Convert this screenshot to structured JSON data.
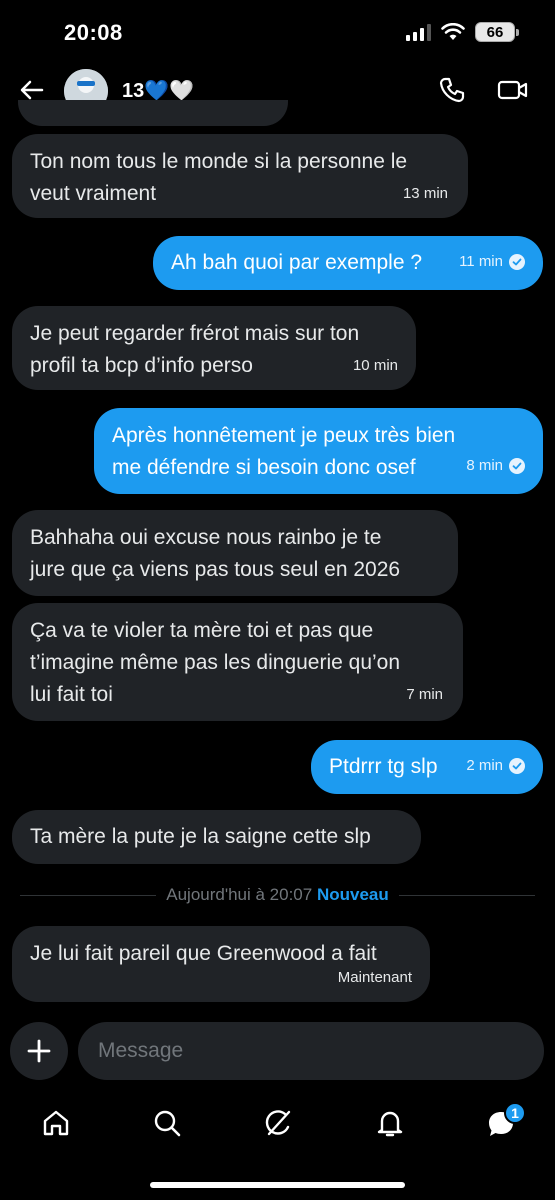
{
  "status_bar": {
    "time": "20:08",
    "battery": "66"
  },
  "header": {
    "contact_name": "13💙🤍"
  },
  "messages": [
    {
      "direction": "in",
      "lines": [
        "Ton nom tous le monde si la personne le",
        "veut vraiment"
      ],
      "time": "13 min"
    },
    {
      "direction": "out",
      "lines": [
        "Ah bah quoi par exemple ?"
      ],
      "time": "11 min"
    },
    {
      "direction": "in",
      "lines": [
        "Je peut regarder frérot mais sur ton",
        "profil ta bcp d’info perso"
      ],
      "time": "10 min"
    },
    {
      "direction": "out",
      "lines": [
        "Après honnêtement je peux très bien",
        "me défendre si besoin donc osef"
      ],
      "time": "8 min"
    },
    {
      "direction": "in",
      "lines": [
        "Bahhaha oui excuse nous rainbo je te",
        "jure que ça viens pas tous seul en 2026"
      ],
      "time": ""
    },
    {
      "direction": "in",
      "lines": [
        "Ça va te violer ta mère toi et pas que",
        "t’imagine même pas les dinguerie qu’on",
        "lui fait toi"
      ],
      "time": "7 min"
    },
    {
      "direction": "out",
      "lines": [
        "Ptdrrr tg slp"
      ],
      "time": "2 min"
    },
    {
      "direction": "in",
      "lines": [
        "Ta mère la pute je la saigne cette slp"
      ],
      "time": ""
    },
    {
      "direction": "in",
      "lines": [
        "Je lui fait pareil que Greenwood a fait"
      ],
      "time": "Maintenant"
    }
  ],
  "divider": {
    "label": "Aujourd'hui à 20:07",
    "new_label": "Nouveau"
  },
  "composer": {
    "placeholder": "Message"
  },
  "nav": {
    "items": [
      "home-icon",
      "search-icon",
      "grok-icon",
      "notifications-icon",
      "messages-icon"
    ],
    "messages_badge": "1"
  },
  "colors": {
    "outgoing": "#1d9bf0",
    "incoming": "#202327",
    "background": "#000000"
  }
}
